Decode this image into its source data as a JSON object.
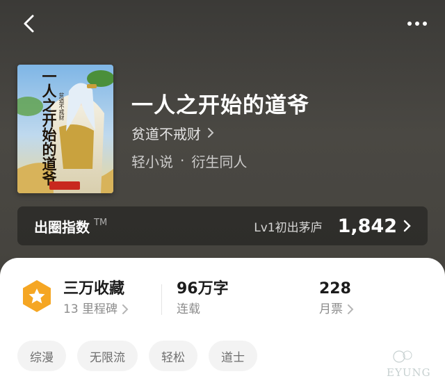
{
  "header": {
    "back_icon": "chevron-left-icon",
    "more_icon": "more-dots-icon"
  },
  "book": {
    "cover_title": "一人之开始的道爷",
    "cover_author": "贫道不戒财",
    "title": "一人之开始的道爷",
    "author": "贫道不戒财",
    "category": "轻小说",
    "separator": "·",
    "subcategory": "衍生同人"
  },
  "index": {
    "title": "出圈指数",
    "trademark": "TM",
    "level": "Lv1初出茅庐",
    "value": "1,842"
  },
  "stats": {
    "badge_icon": "star-hexagon-icon",
    "collection": {
      "main": "三万收藏",
      "sub": "13 里程碑"
    },
    "words": {
      "main": "96万字",
      "sub": "连载"
    },
    "tickets": {
      "main": "228",
      "sub": "月票"
    }
  },
  "tags": [
    "综漫",
    "无限流",
    "轻松",
    "道士"
  ],
  "watermark": {
    "text": "EYUNG"
  },
  "colors": {
    "accent_orange": "#f5a623",
    "background": "#45433e",
    "card": "#ffffff"
  }
}
